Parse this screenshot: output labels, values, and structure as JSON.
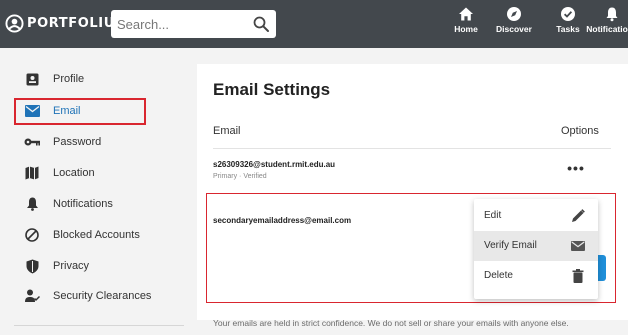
{
  "header": {
    "brand": "PORTFOLIUM",
    "search_placeholder": "Search...",
    "nav": [
      {
        "label": "Home",
        "icon": "home-icon"
      },
      {
        "label": "Discover",
        "icon": "compass-icon"
      },
      {
        "label": "Tasks",
        "icon": "check-circle-icon"
      },
      {
        "label": "Notifications",
        "icon": "bell-icon"
      }
    ]
  },
  "sidebar": {
    "items": [
      {
        "label": "Profile",
        "icon": "id-card-icon"
      },
      {
        "label": "Email",
        "icon": "envelope-icon",
        "active": true
      },
      {
        "label": "Password",
        "icon": "key-icon"
      },
      {
        "label": "Location",
        "icon": "map-icon"
      },
      {
        "label": "Notifications",
        "icon": "bell-icon"
      },
      {
        "label": "Blocked Accounts",
        "icon": "block-icon"
      },
      {
        "label": "Privacy",
        "icon": "shield-icon"
      },
      {
        "label": "Security Clearances",
        "icon": "user-check-icon"
      }
    ]
  },
  "main": {
    "title": "Email Settings",
    "col_email": "Email",
    "col_options": "Options",
    "emails": [
      {
        "address": "s26309326@student.rmit.edu.au",
        "meta": "Primary · Verified"
      },
      {
        "address": "secondaryemailaddress@email.com",
        "meta": ""
      }
    ],
    "more_label": "•••",
    "menu": [
      {
        "label": "Edit",
        "icon": "pencil-icon"
      },
      {
        "label": "Verify Email",
        "icon": "envelope-icon"
      },
      {
        "label": "Delete",
        "icon": "trash-icon"
      }
    ],
    "footer_note": "Your emails are held in strict confidence. We do not sell or share your emails with anyone else."
  },
  "colors": {
    "topbar": "#43484d",
    "accent": "#1f73b7",
    "highlight": "#d9262f"
  }
}
